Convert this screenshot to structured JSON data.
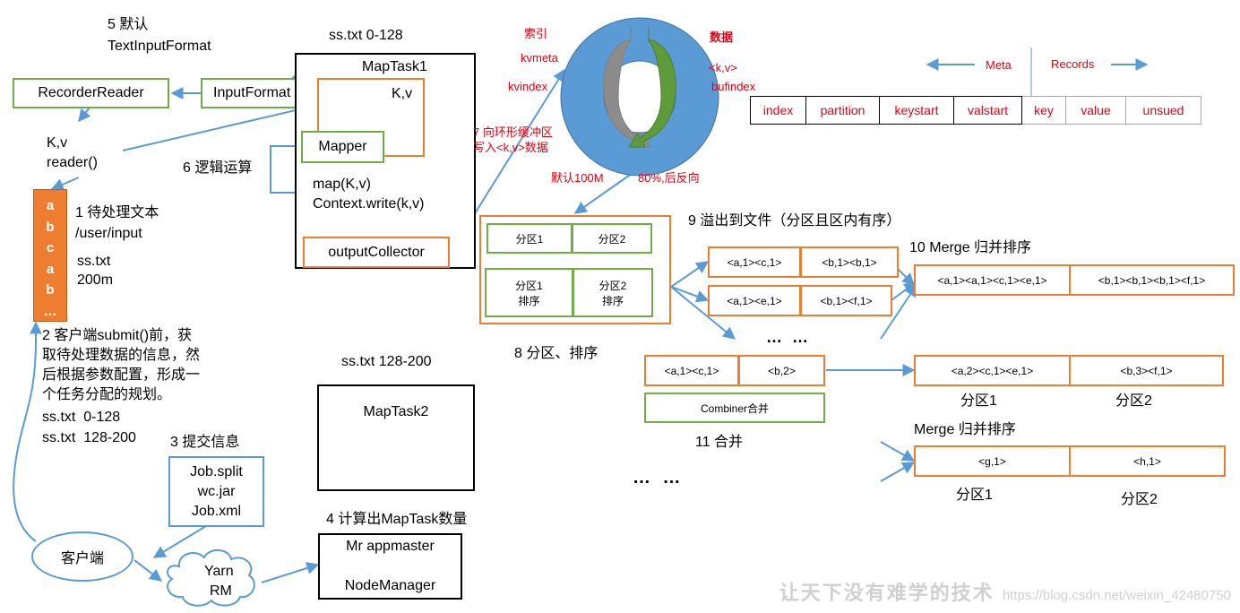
{
  "step5": {
    "label": "5 默认",
    "sublabel": "TextInputFormat"
  },
  "recorder_reader": "RecorderReader",
  "input_format": "InputFormat",
  "kv_reader": {
    "line1": "K,v",
    "line2": "reader()"
  },
  "step6": "6 逻辑运算",
  "maptask1": {
    "split_label": "ss.txt 0-128",
    "title": "MapTask1",
    "kv": "K,v",
    "mapper": "Mapper",
    "map_call": "map(K,v)",
    "context_write": "Context.write(k,v)",
    "output_collector": "outputCollector"
  },
  "input_file": {
    "letters": [
      "a",
      "b",
      "c",
      "a",
      "b",
      "…"
    ],
    "step1": "1 待处理文本",
    "path": "/user/input",
    "file": "ss.txt",
    "size": "200m",
    "color": "#ed7d31"
  },
  "step2": {
    "lines": [
      "2 客户端submit()前，获",
      "取待处理数据的信息，然",
      "后根据参数配置，形成一",
      "个任务分配的规划。"
    ],
    "splits": [
      "ss.txt  0-128",
      "ss.txt  128-200"
    ]
  },
  "step3": {
    "label": "3 提交信息",
    "files": [
      "Job.split",
      "wc.jar",
      "Job.xml"
    ]
  },
  "client": "客户端",
  "yarn": {
    "line1": "Yarn",
    "line2": "RM"
  },
  "step4": "4 计算出MapTask数量",
  "appmaster": {
    "line1": "Mr appmaster",
    "line2": "NodeManager"
  },
  "maptask2": {
    "split_label": "ss.txt 128-200",
    "title": "MapTask2"
  },
  "ring_buffer": {
    "index_label": "索引",
    "kvmeta": "kvmeta",
    "kvindex": "kvindex",
    "data_label": "数据",
    "kv": "<k,v>",
    "bufindex": "bufindex",
    "step7_line1": "7 向环形缓冲区",
    "step7_line2": "写入<k,v>数据",
    "default_size": "默认100M",
    "threshold": "80%,后反向",
    "ring_color": "#5b9bd5",
    "index_arrow_color": "#8c8c8c",
    "data_arrow_color": "#5f9b3a"
  },
  "meta_records": {
    "meta_label": "Meta",
    "records_label": "Records",
    "meta_cells": [
      "index",
      "partition",
      "keystart",
      "valstart"
    ],
    "record_cells": [
      "key",
      "value",
      "unsued"
    ]
  },
  "partition_sort": {
    "p1": "分区1",
    "p2": "分区2",
    "p1_sort_line1": "分区1",
    "p1_sort_line2": "排序",
    "p2_sort_line1": "分区2",
    "p2_sort_line2": "排序",
    "step8": "8 分区、排序"
  },
  "spill": {
    "step9": "9 溢出到文件（分区且区内有序）",
    "files": [
      [
        "<a,1><c,1>",
        "<b,1><b,1>"
      ],
      [
        "<a,1><e,1>",
        "<b,1><f,1>"
      ]
    ],
    "ellipsis": "… …"
  },
  "merge10": {
    "label": "10 Merge 归并排序",
    "cells": [
      "<a,1><a,1><c,1><e,1>",
      "<b,1><b,1><b,1><f,1>"
    ]
  },
  "combiner": {
    "cells": [
      "<a,1><c,1>",
      "<b,2>"
    ],
    "label": "Combiner合并",
    "step11": "11 合并"
  },
  "combined_result": {
    "cells": [
      "<a,2><c,1><e,1>",
      "<b,3><f,1>"
    ],
    "p1": "分区1",
    "p2": "分区2"
  },
  "merge2": {
    "label": "Merge 归并排序",
    "cells": [
      "<g,1>",
      "<h,1>"
    ],
    "p1": "分区1",
    "p2": "分区2"
  },
  "bottom_ellipsis": "… …",
  "watermark": {
    "text": "让天下没有难学的技术",
    "url": "https://blog.csdn.net/weixin_42480750"
  }
}
